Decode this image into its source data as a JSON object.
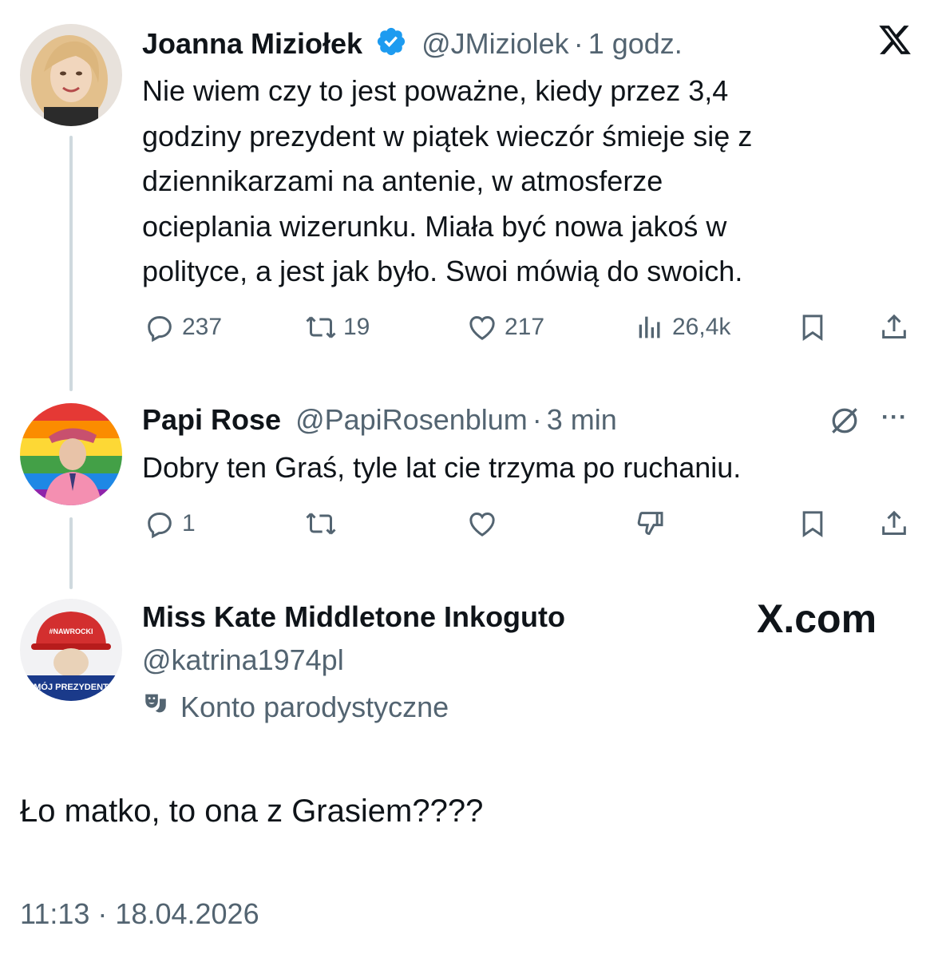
{
  "tweets": [
    {
      "author": "Joanna Miziołek",
      "verified": true,
      "handle": "@JMiziolek",
      "separator": "·",
      "time": "1 godz.",
      "text": "Nie wiem czy to jest poważne, kiedy przez 3,4 godziny prezydent w piątek wieczór śmieje się z dziennikarzami na antenie, w atmosferze ocieplania wizerunku. Miała być nowa jakoś w polityce, a jest jak było. Swoi mówią do swoich.",
      "text_lines": [
        "Nie wiem czy to jest poważne, kiedy przez 3,4",
        "godziny prezydent w piątek wieczór śmieje się z",
        "dziennikarzami na antenie, w atmosferze",
        "ocieplania wizerunku. Miała być nowa jakoś w",
        "polityce, a jest jak było. Swoi mówią do swoich."
      ],
      "replies": "237",
      "reposts": "19",
      "likes": "217",
      "views": "26,4k",
      "icons": [
        "reply-icon",
        "repost-icon",
        "like-icon",
        "views-icon",
        "bookmark-icon",
        "share-icon",
        "x-logo-icon",
        "verified-badge-icon"
      ]
    },
    {
      "author": "Papi Rose",
      "handle": "@PapiRosenblum",
      "separator": "·",
      "time": "3 min",
      "text": "Dobry ten Graś, tyle lat cie trzyma po ruchaniu.",
      "replies": "1",
      "more": "···",
      "icons": [
        "reply-icon",
        "repost-icon",
        "like-icon",
        "dislike-icon",
        "bookmark-icon",
        "share-icon",
        "grok-icon",
        "more-icon"
      ]
    },
    {
      "author": "Miss Kate Middletone Inkoguto",
      "handle": "@katrina1974pl",
      "label": "Konto parodystyczne",
      "label_icon": "parody-mask-icon",
      "text": "Ło matko, to ona z Grasiem????",
      "timestamp": "11:13 · 18.04.2026",
      "site_logo": "X.com"
    }
  ],
  "avatars": {
    "joanna": {
      "icon": "avatar-photo",
      "colors": [
        "#d9b38c",
        "#f3e0c8",
        "#8a6a4e"
      ]
    },
    "papi": {
      "icon": "avatar-photo",
      "colors": [
        "#e53935",
        "#fb8c00",
        "#fdd835",
        "#43a047",
        "#1e88e5",
        "#8e24aa",
        "#f48fb1"
      ]
    },
    "kate": {
      "icon": "avatar-photo",
      "colors": [
        "#d32f2f",
        "#1a3a8a",
        "#e9d2b8"
      ]
    }
  },
  "colors": {
    "verified": "#1d9bf0",
    "muted": "#536471",
    "line": "#cfd9de",
    "text": "#0f1419"
  }
}
